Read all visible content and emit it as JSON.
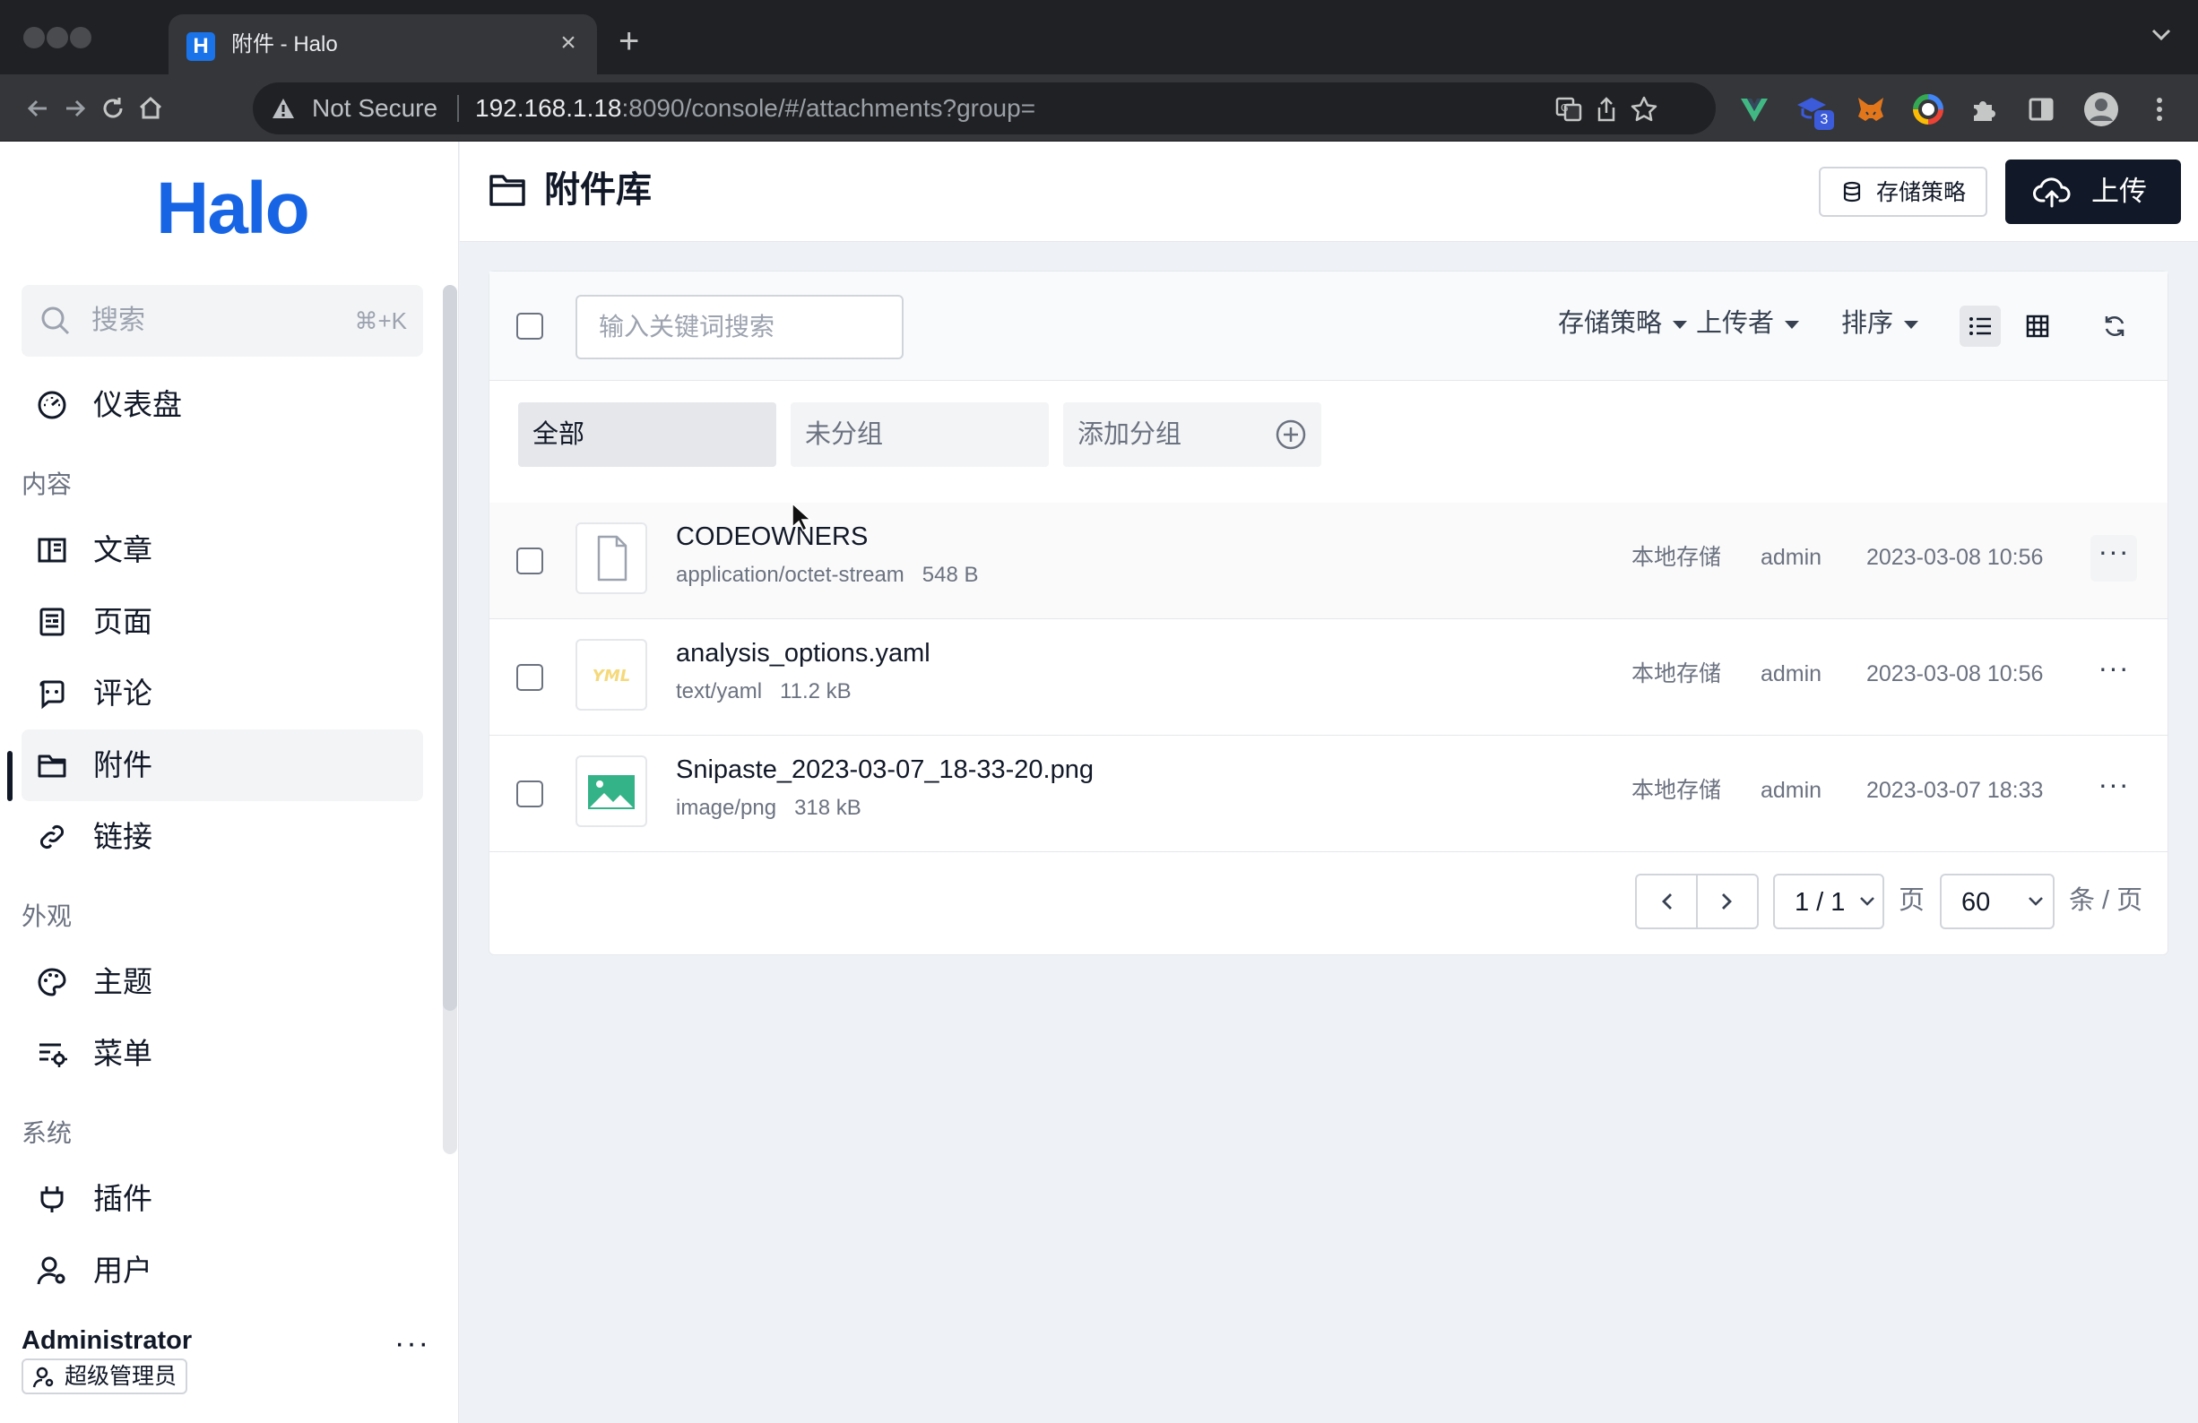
{
  "browser": {
    "tab_title": "附件 - Halo",
    "favicon_letter": "H",
    "security_label": "Not Secure",
    "url_host": "192.168.1.18",
    "url_rest": ":8090/console/#/attachments?group=",
    "extension_badge": "3"
  },
  "sidebar": {
    "logo": "Halo",
    "search": {
      "placeholder": "搜索",
      "shortcut": "⌘+K"
    },
    "dashboard": "仪表盘",
    "groups": {
      "content": "内容",
      "appearance": "外观",
      "system": "系统"
    },
    "items": {
      "posts": "文章",
      "pages": "页面",
      "comments": "评论",
      "attachments": "附件",
      "links": "链接",
      "themes": "主题",
      "menus": "菜单",
      "plugins": "插件",
      "users": "用户"
    },
    "active_item": "attachments",
    "user": {
      "name": "Administrator",
      "role": "超级管理员",
      "more": "···"
    }
  },
  "header": {
    "title": "附件库",
    "storage_button": "存储策略",
    "upload_button": "上传"
  },
  "toolbar": {
    "search_placeholder": "输入关键词搜索",
    "filters": {
      "storage": "存储策略",
      "uploader": "上传者",
      "sort": "排序"
    },
    "view_mode": "list"
  },
  "groups": {
    "all": "全部",
    "ungrouped": "未分组",
    "add": "添加分组",
    "selected": "all"
  },
  "attachments": [
    {
      "name": "CODEOWNERS",
      "type": "application/octet-stream",
      "size": "548 B",
      "storage": "本地存储",
      "owner": "admin",
      "date": "2023-03-08 10:56",
      "thumb": "file-icon"
    },
    {
      "name": "analysis_options.yaml",
      "type": "text/yaml",
      "size": "11.2 kB",
      "storage": "本地存储",
      "owner": "admin",
      "date": "2023-03-08 10:56",
      "thumb": "yaml-icon",
      "thumb_text": "YML"
    },
    {
      "name": "Snipaste_2023-03-07_18-33-20.png",
      "type": "image/png",
      "size": "318 kB",
      "storage": "本地存储",
      "owner": "admin",
      "date": "2023-03-07 18:33",
      "thumb": "image-icon"
    }
  ],
  "pagination": {
    "page": "1 / 1",
    "page_unit": "页",
    "size": "60",
    "size_unit": "条 / 页"
  },
  "colors": {
    "brand": "#1765e5",
    "primary_button": "#111827",
    "page_bg": "#eef2f7"
  }
}
